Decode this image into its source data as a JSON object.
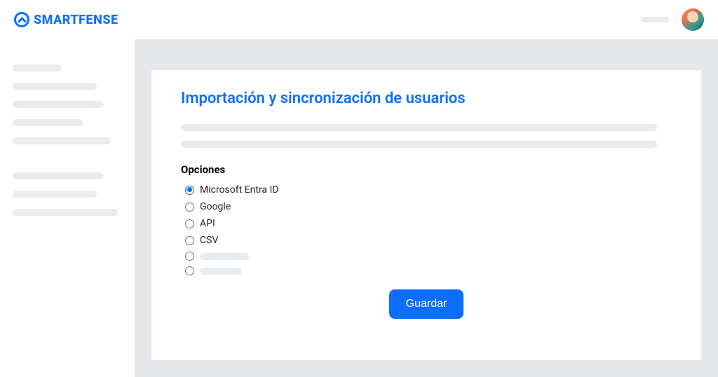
{
  "brand": "SMARTFENSE",
  "page": {
    "title": "Importación y sincronización de usuarios",
    "options_label": "Opciones",
    "options": {
      "entra": "Microsoft Entra ID",
      "google": "Google",
      "api": "API",
      "csv": "CSV"
    },
    "save_label": "Guardar"
  }
}
